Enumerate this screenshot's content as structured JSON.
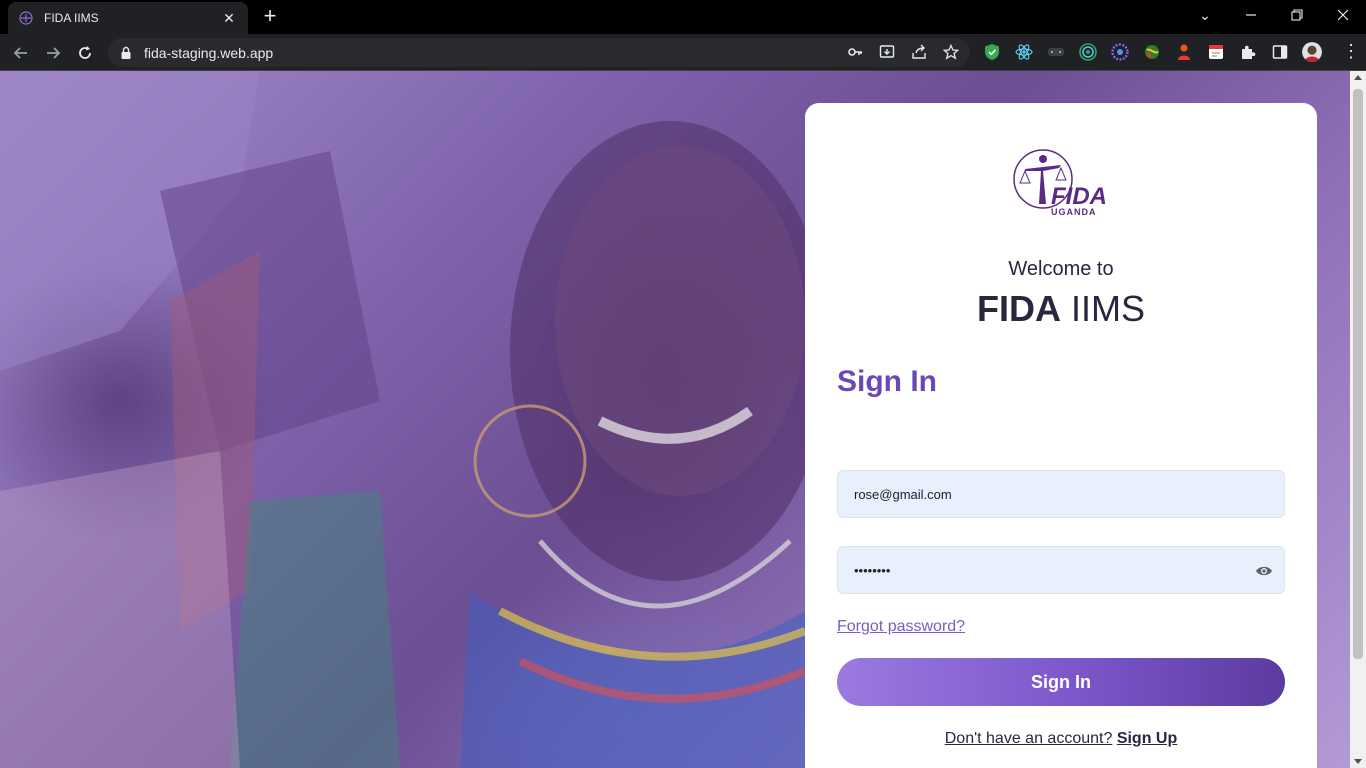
{
  "browser": {
    "tab_title": "FIDA IIMS",
    "url": "fida-staging.web.app"
  },
  "page": {
    "welcome": "Welcome to",
    "app_name_bold": "FIDA",
    "app_name_light": "IIMS",
    "logo_text": "FIDA",
    "logo_subtext": "UGANDA",
    "heading": "Sign In",
    "email_value": "rose@gmail.com",
    "password_value": "••••••••",
    "forgot_link": "Forgot password?",
    "submit_label": "Sign In",
    "signup_prompt": "Don't have an account?",
    "signup_link": "Sign Up"
  },
  "colors": {
    "accent": "#6a48b8",
    "button_start": "#9b7ae0",
    "button_end": "#5c3b9f",
    "field_bg": "#e8f0fe"
  }
}
